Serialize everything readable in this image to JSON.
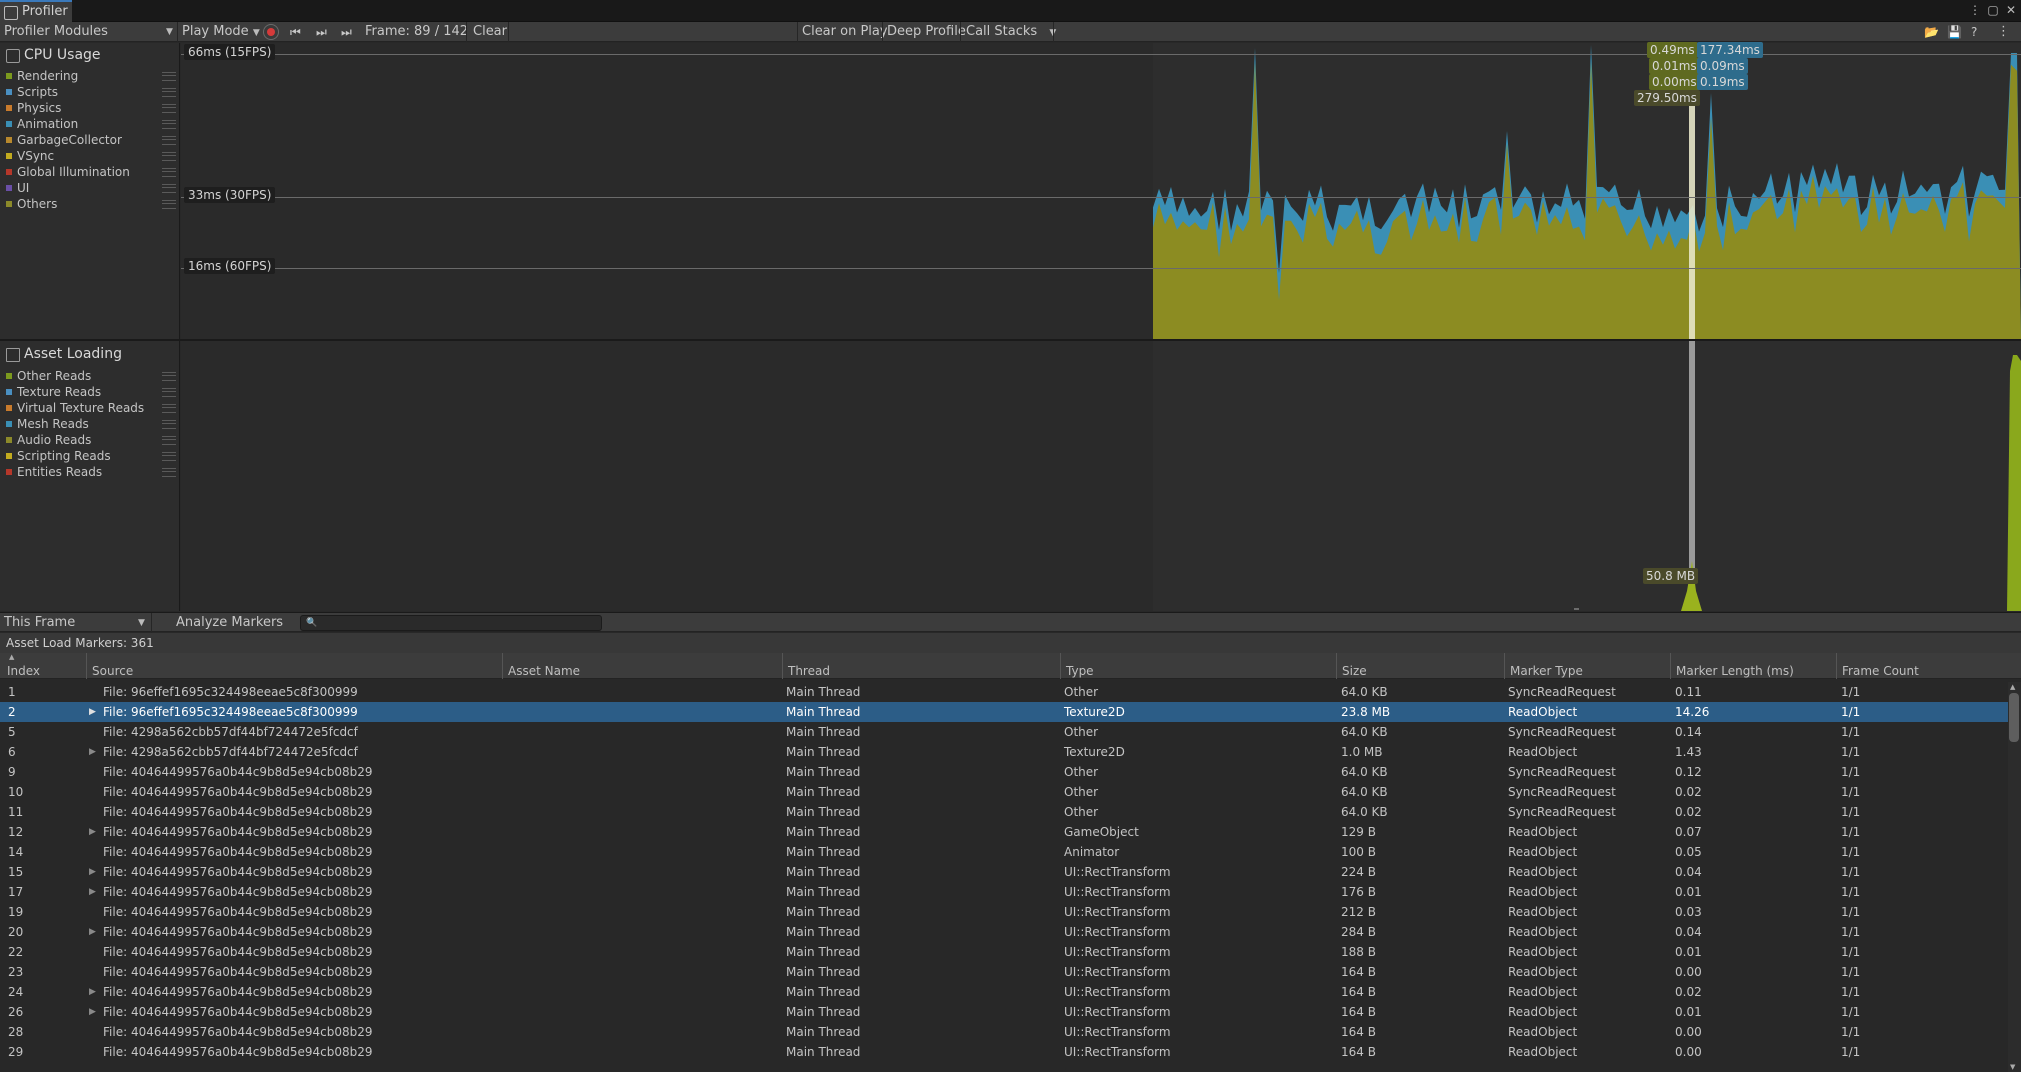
{
  "window": {
    "tab_title": "Profiler",
    "menu_icon": "kebab-menu-icon",
    "maximize_icon": "maximize-icon",
    "close_icon": "close-icon"
  },
  "toolbar": {
    "modules_dropdown": "Profiler Modules",
    "play_mode": "Play Mode",
    "frame_label": "Frame: 89 / 142",
    "clear": "Clear",
    "clear_on_play": "Clear on Play",
    "deep_profile": "Deep Profile",
    "call_stacks": "Call Stacks"
  },
  "cpu_module": {
    "title": "CPU Usage",
    "legend": [
      {
        "label": "Rendering",
        "color": "#7c9a1e"
      },
      {
        "label": "Scripts",
        "color": "#4a8fc0"
      },
      {
        "label": "Physics",
        "color": "#c97b2c"
      },
      {
        "label": "Animation",
        "color": "#3a8fb5"
      },
      {
        "label": "GarbageCollector",
        "color": "#b8892d"
      },
      {
        "label": "VSync",
        "color": "#c2ab1f"
      },
      {
        "label": "Global Illumination",
        "color": "#b5372a"
      },
      {
        "label": "UI",
        "color": "#6a4fa6"
      },
      {
        "label": "Others",
        "color": "#8c8a2a"
      }
    ],
    "guides": [
      "66ms (15FPS)",
      "33ms (30FPS)",
      "16ms (60FPS)"
    ],
    "tooltips": [
      "0.49ms",
      "177.34ms",
      "0.01ms",
      "0.09ms",
      "0.00ms",
      "0.19ms",
      "279.50ms"
    ]
  },
  "asset_module": {
    "title": "Asset Loading",
    "legend": [
      {
        "label": "Other Reads",
        "color": "#7c9a1e"
      },
      {
        "label": "Texture Reads",
        "color": "#4a8fc0"
      },
      {
        "label": "Virtual Texture Reads",
        "color": "#c97b2c"
      },
      {
        "label": "Mesh Reads",
        "color": "#3a8fb5"
      },
      {
        "label": "Audio Reads",
        "color": "#8c8a2a"
      },
      {
        "label": "Scripting Reads",
        "color": "#c2ab1f"
      },
      {
        "label": "Entities Reads",
        "color": "#b5372a"
      }
    ],
    "tooltip": "50.8 MB"
  },
  "details": {
    "view_dropdown": "This Frame",
    "analyze_markers": "Analyze Markers",
    "search_placeholder": "",
    "summary": "Asset Load Markers: 361"
  },
  "table": {
    "columns": [
      "Index",
      "Source",
      "Asset Name",
      "Thread",
      "Type",
      "Size",
      "Marker Type",
      "Marker Length (ms)",
      "Frame Count"
    ],
    "rows": [
      {
        "index": "1",
        "expandable": false,
        "selected": false,
        "source": "File: 96effef1695c324498eeae5c8f300999",
        "asset": "",
        "thread": "Main Thread",
        "type": "Other",
        "size": "64.0 KB",
        "marker_type": "SyncReadRequest",
        "length": "0.11",
        "frames": "1/1"
      },
      {
        "index": "2",
        "expandable": true,
        "selected": true,
        "source": "File: 96effef1695c324498eeae5c8f300999",
        "asset": "",
        "thread": "Main Thread",
        "type": "Texture2D",
        "size": "23.8 MB",
        "marker_type": "ReadObject",
        "length": "14.26",
        "frames": "1/1"
      },
      {
        "index": "5",
        "expandable": false,
        "selected": false,
        "source": "File: 4298a562cbb57df44bf724472e5fcdcf",
        "asset": "",
        "thread": "Main Thread",
        "type": "Other",
        "size": "64.0 KB",
        "marker_type": "SyncReadRequest",
        "length": "0.14",
        "frames": "1/1"
      },
      {
        "index": "6",
        "expandable": true,
        "selected": false,
        "source": "File: 4298a562cbb57df44bf724472e5fcdcf",
        "asset": "",
        "thread": "Main Thread",
        "type": "Texture2D",
        "size": "1.0 MB",
        "marker_type": "ReadObject",
        "length": "1.43",
        "frames": "1/1"
      },
      {
        "index": "9",
        "expandable": false,
        "selected": false,
        "source": "File: 40464499576a0b44c9b8d5e94cb08b29",
        "asset": "",
        "thread": "Main Thread",
        "type": "Other",
        "size": "64.0 KB",
        "marker_type": "SyncReadRequest",
        "length": "0.12",
        "frames": "1/1"
      },
      {
        "index": "10",
        "expandable": false,
        "selected": false,
        "source": "File: 40464499576a0b44c9b8d5e94cb08b29",
        "asset": "",
        "thread": "Main Thread",
        "type": "Other",
        "size": "64.0 KB",
        "marker_type": "SyncReadRequest",
        "length": "0.02",
        "frames": "1/1"
      },
      {
        "index": "11",
        "expandable": false,
        "selected": false,
        "source": "File: 40464499576a0b44c9b8d5e94cb08b29",
        "asset": "",
        "thread": "Main Thread",
        "type": "Other",
        "size": "64.0 KB",
        "marker_type": "SyncReadRequest",
        "length": "0.02",
        "frames": "1/1"
      },
      {
        "index": "12",
        "expandable": true,
        "selected": false,
        "source": "File: 40464499576a0b44c9b8d5e94cb08b29",
        "asset": "",
        "thread": "Main Thread",
        "type": "GameObject",
        "size": "129 B",
        "marker_type": "ReadObject",
        "length": "0.07",
        "frames": "1/1"
      },
      {
        "index": "14",
        "expandable": false,
        "selected": false,
        "source": "File: 40464499576a0b44c9b8d5e94cb08b29",
        "asset": "",
        "thread": "Main Thread",
        "type": "Animator",
        "size": "100 B",
        "marker_type": "ReadObject",
        "length": "0.05",
        "frames": "1/1"
      },
      {
        "index": "15",
        "expandable": true,
        "selected": false,
        "source": "File: 40464499576a0b44c9b8d5e94cb08b29",
        "asset": "",
        "thread": "Main Thread",
        "type": "UI::RectTransform",
        "size": "224 B",
        "marker_type": "ReadObject",
        "length": "0.04",
        "frames": "1/1"
      },
      {
        "index": "17",
        "expandable": true,
        "selected": false,
        "source": "File: 40464499576a0b44c9b8d5e94cb08b29",
        "asset": "",
        "thread": "Main Thread",
        "type": "UI::RectTransform",
        "size": "176 B",
        "marker_type": "ReadObject",
        "length": "0.01",
        "frames": "1/1"
      },
      {
        "index": "19",
        "expandable": false,
        "selected": false,
        "source": "File: 40464499576a0b44c9b8d5e94cb08b29",
        "asset": "",
        "thread": "Main Thread",
        "type": "UI::RectTransform",
        "size": "212 B",
        "marker_type": "ReadObject",
        "length": "0.03",
        "frames": "1/1"
      },
      {
        "index": "20",
        "expandable": true,
        "selected": false,
        "source": "File: 40464499576a0b44c9b8d5e94cb08b29",
        "asset": "",
        "thread": "Main Thread",
        "type": "UI::RectTransform",
        "size": "284 B",
        "marker_type": "ReadObject",
        "length": "0.04",
        "frames": "1/1"
      },
      {
        "index": "22",
        "expandable": false,
        "selected": false,
        "source": "File: 40464499576a0b44c9b8d5e94cb08b29",
        "asset": "",
        "thread": "Main Thread",
        "type": "UI::RectTransform",
        "size": "188 B",
        "marker_type": "ReadObject",
        "length": "0.01",
        "frames": "1/1"
      },
      {
        "index": "23",
        "expandable": false,
        "selected": false,
        "source": "File: 40464499576a0b44c9b8d5e94cb08b29",
        "asset": "",
        "thread": "Main Thread",
        "type": "UI::RectTransform",
        "size": "164 B",
        "marker_type": "ReadObject",
        "length": "0.00",
        "frames": "1/1"
      },
      {
        "index": "24",
        "expandable": true,
        "selected": false,
        "source": "File: 40464499576a0b44c9b8d5e94cb08b29",
        "asset": "",
        "thread": "Main Thread",
        "type": "UI::RectTransform",
        "size": "164 B",
        "marker_type": "ReadObject",
        "length": "0.02",
        "frames": "1/1"
      },
      {
        "index": "26",
        "expandable": true,
        "selected": false,
        "source": "File: 40464499576a0b44c9b8d5e94cb08b29",
        "asset": "",
        "thread": "Main Thread",
        "type": "UI::RectTransform",
        "size": "164 B",
        "marker_type": "ReadObject",
        "length": "0.01",
        "frames": "1/1"
      },
      {
        "index": "28",
        "expandable": false,
        "selected": false,
        "source": "File: 40464499576a0b44c9b8d5e94cb08b29",
        "asset": "",
        "thread": "Main Thread",
        "type": "UI::RectTransform",
        "size": "164 B",
        "marker_type": "ReadObject",
        "length": "0.00",
        "frames": "1/1"
      },
      {
        "index": "29",
        "expandable": false,
        "selected": false,
        "source": "File: 40464499576a0b44c9b8d5e94cb08b29",
        "asset": "",
        "thread": "Main Thread",
        "type": "UI::RectTransform",
        "size": "164 B",
        "marker_type": "ReadObject",
        "length": "0.00",
        "frames": "1/1"
      }
    ]
  }
}
